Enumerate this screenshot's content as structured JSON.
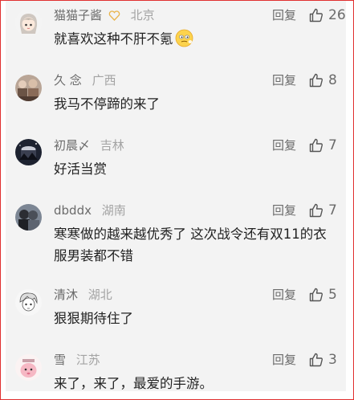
{
  "comments": [
    {
      "username": "猫猫子酱",
      "badge": "heart-badge-icon",
      "location": "北京",
      "text": "就喜欢这种不肝不氪",
      "emoji": "face-emoji-icon",
      "reply_label": "回复",
      "likes": "26",
      "avatar": "anime-girl-avatar"
    },
    {
      "username": "久 念",
      "location": "广西",
      "text": "我马不停蹄的来了",
      "reply_label": "回复",
      "likes": "8",
      "avatar": "group-photo-avatar"
    },
    {
      "username": "初晨〆",
      "location": "吉林",
      "text": "好活当赏",
      "reply_label": "回复",
      "likes": "7",
      "avatar": "night-scene-avatar"
    },
    {
      "username": "dbddx",
      "location": "湖南",
      "text": "寒寒做的越来越优秀了 这次战令还有双11的衣服男装都不错",
      "reply_label": "回复",
      "likes": "7",
      "avatar": "couple-photo-avatar"
    },
    {
      "username": "清沐",
      "location": "湖北",
      "text": "狠狠期待住了",
      "reply_label": "回复",
      "likes": "5",
      "avatar": "sketch-boy-avatar"
    },
    {
      "username": "雪",
      "location": "江苏",
      "text": "来了，来了，最爱的手游。",
      "reply_label": "回复",
      "likes": "3",
      "avatar": "pink-cartoon-avatar"
    }
  ],
  "colors": {
    "text": "#222222",
    "meta": "#8d8d8d",
    "location": "#a3a3a3",
    "background": "#f3f3f3",
    "border": "#e03030"
  }
}
